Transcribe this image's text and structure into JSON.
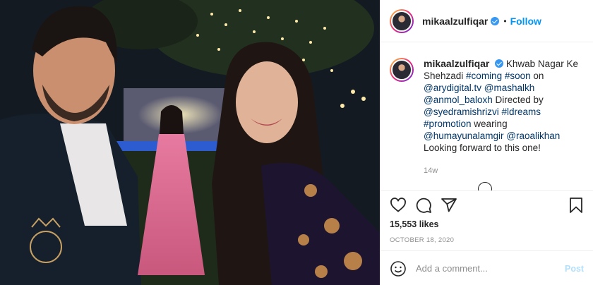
{
  "post": {
    "author": "mikaalzulfiqar",
    "follow_label": "Follow",
    "separator": "•"
  },
  "caption": {
    "author": "mikaalzulfiqar",
    "segments": [
      {
        "text": "Khwab Nagar Ke Shehzadi ",
        "tag": false
      },
      {
        "text": "#coming",
        "tag": true
      },
      {
        "text": " ",
        "tag": false
      },
      {
        "text": "#soon",
        "tag": true
      },
      {
        "text": " on ",
        "tag": false
      },
      {
        "text": "@arydigital.tv",
        "tag": true
      },
      {
        "text": " ",
        "tag": false
      },
      {
        "text": "@mashalkh",
        "tag": true
      },
      {
        "text": " ",
        "tag": false
      },
      {
        "text": "@anmol_baloxh",
        "tag": true
      },
      {
        "text": " Directed by ",
        "tag": false
      },
      {
        "text": "@syedramishrizvi",
        "tag": true
      },
      {
        "text": " ",
        "tag": false
      },
      {
        "text": "#ldreams",
        "tag": true
      },
      {
        "text": " ",
        "tag": false
      },
      {
        "text": "#promotion",
        "tag": true
      },
      {
        "text": " wearing ",
        "tag": false
      },
      {
        "text": "@humayunalamgir",
        "tag": true
      },
      {
        "text": " ",
        "tag": false
      },
      {
        "text": "@raoalikhan",
        "tag": true
      },
      {
        "text": " Looking forward to this one!",
        "tag": false
      }
    ],
    "time_ago": "14w"
  },
  "engagement": {
    "likes": "15,553 likes",
    "date": "OCTOBER 18, 2020"
  },
  "comment_box": {
    "placeholder": "Add a comment...",
    "post_label": "Post"
  },
  "icons": {
    "like": "heart-icon",
    "comment": "comment-bubble-icon",
    "share": "paper-plane-icon",
    "save": "bookmark-icon",
    "emoji": "smiley-icon",
    "verified": "verified-badge-icon"
  },
  "colors": {
    "link": "#00376b",
    "follow": "#0095f6",
    "post_disabled": "#b2dffc",
    "verified": "#3897f0",
    "muted": "#8e8e8e"
  }
}
